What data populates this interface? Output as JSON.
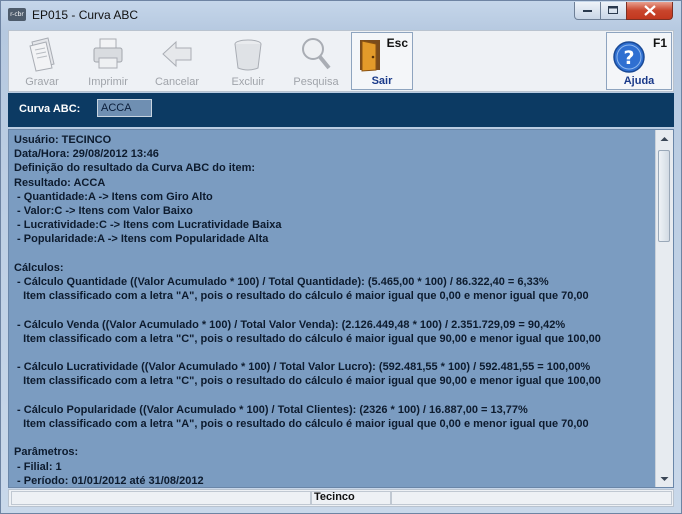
{
  "window": {
    "title": "EP015 - Curva ABC",
    "app_icon_text": "r-cbr"
  },
  "toolbar": {
    "gravar": "Gravar",
    "imprimir": "Imprimir",
    "cancelar": "Cancelar",
    "excluir": "Excluir",
    "pesquisa": "Pesquisa",
    "sair": "Sair",
    "sair_key": "Esc",
    "ajuda": "Ajuda",
    "ajuda_key": "F1"
  },
  "header": {
    "label": "Curva ABC:",
    "value": "ACCA"
  },
  "report": {
    "lines": [
      "Usuário: TECINCO",
      "Data/Hora: 29/08/2012 13:46",
      "Definição do resultado da Curva ABC do item:",
      "Resultado: ACCA",
      " - Quantidade:A -> Itens com Giro Alto",
      " - Valor:C -> Itens com Valor Baixo",
      " - Lucratividade:C -> Itens com Lucratividade Baixa",
      " - Popularidade:A -> Itens com Popularidade Alta",
      "",
      "Cálculos:",
      " - Cálculo Quantidade ((Valor Acumulado * 100) / Total Quantidade): (5.465,00 * 100) / 86.322,40 = 6,33%",
      "   Item classificado com a letra \"A\", pois o resultado do cálculo é maior igual que 0,00 e menor igual que 70,00",
      "",
      " - Cálculo Venda ((Valor Acumulado * 100) / Total Valor Venda): (2.126.449,48 * 100) / 2.351.729,09 = 90,42%",
      "   Item classificado com a letra \"C\", pois o resultado do cálculo é maior igual que 90,00 e menor igual que 100,00",
      "",
      " - Cálculo Lucratividade ((Valor Acumulado * 100) / Total Valor Lucro): (592.481,55 * 100) / 592.481,55 = 100,00%",
      "   Item classificado com a letra \"C\", pois o resultado do cálculo é maior igual que 90,00 e menor igual que 100,00",
      "",
      " - Cálculo Popularidade ((Valor Acumulado * 100) / Total Clientes): (2326 * 100) / 16.887,00 = 13,77%",
      "   Item classificado com a letra \"A\", pois o resultado do cálculo é maior igual que 0,00 e menor igual que 70,00",
      "",
      "Parâmetros:",
      " - Filial: 1",
      " - Período: 01/01/2012 até 31/08/2012"
    ]
  },
  "statusbar": {
    "user": "Tecinco"
  }
}
